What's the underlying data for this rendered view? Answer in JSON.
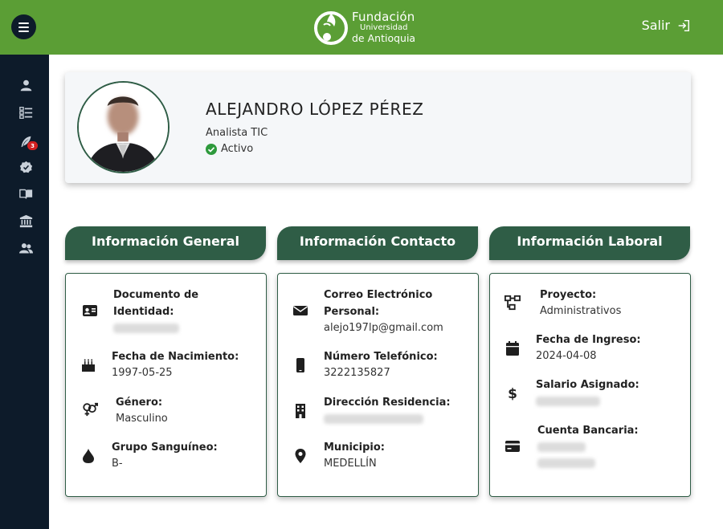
{
  "header": {
    "logo_line1": "Fundación",
    "logo_line2": "Universidad",
    "logo_line3": "de Antioquia",
    "logout_label": "Salir",
    "logout_icon": "sign-in-icon",
    "menu_icon": "hamburger-icon"
  },
  "sidebar": {
    "items": [
      {
        "icon": "user-icon"
      },
      {
        "icon": "task-list-icon"
      },
      {
        "icon": "feather-icon",
        "badge": "3"
      },
      {
        "icon": "badge-check-icon"
      },
      {
        "icon": "book-icon"
      },
      {
        "icon": "bank-icon"
      },
      {
        "icon": "users-icon"
      }
    ]
  },
  "profile": {
    "name": "ALEJANDRO LÓPEZ PÉREZ",
    "role": "Analista TIC",
    "status": "Activo"
  },
  "sections": {
    "general": {
      "title": "Información General",
      "fields": [
        {
          "label": "Documento de Identidad:",
          "value": "",
          "icon": "id-card-icon",
          "redacted": true
        },
        {
          "label": "Fecha de Nacimiento:",
          "value": "1997-05-25",
          "icon": "birthday-cake-icon"
        },
        {
          "label": "Género:",
          "value": "Masculino",
          "icon": "gender-icon"
        },
        {
          "label": "Grupo Sanguíneo:",
          "value": "B-",
          "icon": "blood-drop-icon"
        }
      ]
    },
    "contact": {
      "title": "Información Contacto",
      "fields": [
        {
          "label": "Correo Electrónico Personal:",
          "value": "alejo197lp@gmail.com",
          "icon": "envelope-icon"
        },
        {
          "label": "Número Telefónico:",
          "value": "3222135827",
          "icon": "mobile-phone-icon"
        },
        {
          "label": "Dirección Residencia:",
          "value": "",
          "icon": "building-icon",
          "redacted": true
        },
        {
          "label": "Municipio:",
          "value": "MEDELLÍN",
          "icon": "location-pin-icon"
        }
      ]
    },
    "work": {
      "title": "Información Laboral",
      "fields": [
        {
          "label": "Proyecto:",
          "value": "Administrativos",
          "icon": "project-diagram-icon"
        },
        {
          "label": "Fecha de Ingreso:",
          "value": "2024-04-08",
          "icon": "calendar-icon"
        },
        {
          "label": "Salario Asignado:",
          "value": "",
          "icon": "dollar-icon",
          "redacted": true
        },
        {
          "label": "Cuenta Bancaria:",
          "value": "",
          "icon": "credit-card-icon",
          "redacted": true
        }
      ]
    }
  },
  "colors": {
    "topbar": "#5b9e35",
    "sidebar": "#0d1b2a",
    "section_header": "#2f5d46",
    "status_ok": "#2e9a3c",
    "badge": "#d32020"
  }
}
